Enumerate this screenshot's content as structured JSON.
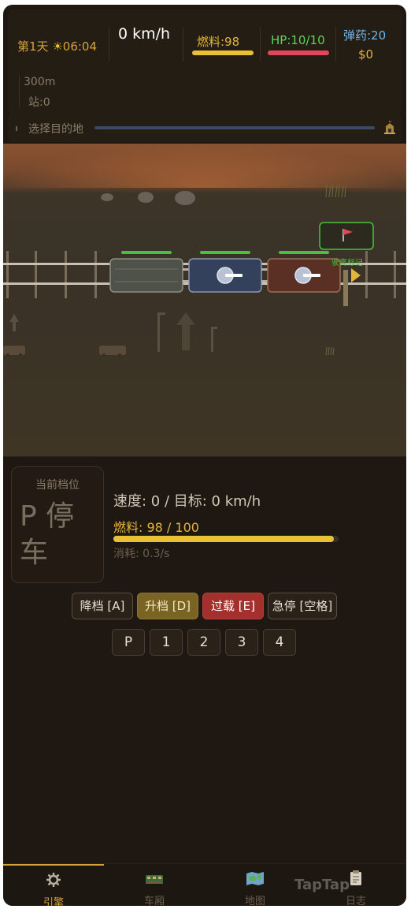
{
  "hud": {
    "day": "第1天",
    "time": "06:04",
    "speed": "0 km/h",
    "fuel": "燃料:98",
    "fuel_fraction": 0.98,
    "hp": "HP:10/10",
    "hp_fraction": 1.0,
    "ammo": "弹药:20",
    "money": "$0",
    "distance": "300m",
    "station": "站:0"
  },
  "destination": {
    "label": "选择目的地"
  },
  "scene": {
    "marker_label": "驶离标记",
    "cars": [
      {
        "type": "engine",
        "color": "#4e5248",
        "hp_fraction": 1.0
      },
      {
        "type": "turret",
        "color": "#33415c",
        "hp_fraction": 1.0
      },
      {
        "type": "turret",
        "color": "#5a3025",
        "hp_fraction": 1.0
      }
    ]
  },
  "panel": {
    "gear_title": "当前档位",
    "gear_value": "P 停车",
    "speed_line": "速度: 0 / 目标: 0 km/h",
    "fuel_line": "燃料: 98 / 100",
    "fuel_fraction": 0.98,
    "consumption": "消耗: 0.3/s",
    "buttons": {
      "down": "降档 [A]",
      "up": "升档 [D]",
      "overload": "过载 [E]",
      "brake": "急停 [空格]"
    },
    "gears": [
      "P",
      "1",
      "2",
      "3",
      "4"
    ]
  },
  "nav": {
    "items": [
      {
        "label": "引擎",
        "icon": "gear-icon",
        "active": true
      },
      {
        "label": "车厢",
        "icon": "train-car-icon",
        "active": false
      },
      {
        "label": "地图",
        "icon": "map-icon",
        "active": false
      },
      {
        "label": "日志",
        "icon": "clipboard-icon",
        "active": false
      }
    ],
    "watermark": "TapTap"
  },
  "colors": {
    "accent": "#d7a13a",
    "fuel": "#e7c236",
    "hp": "#e0485a",
    "hp_text": "#5fd25a",
    "ammo": "#6fb6ee",
    "overload": "#a3302c"
  }
}
